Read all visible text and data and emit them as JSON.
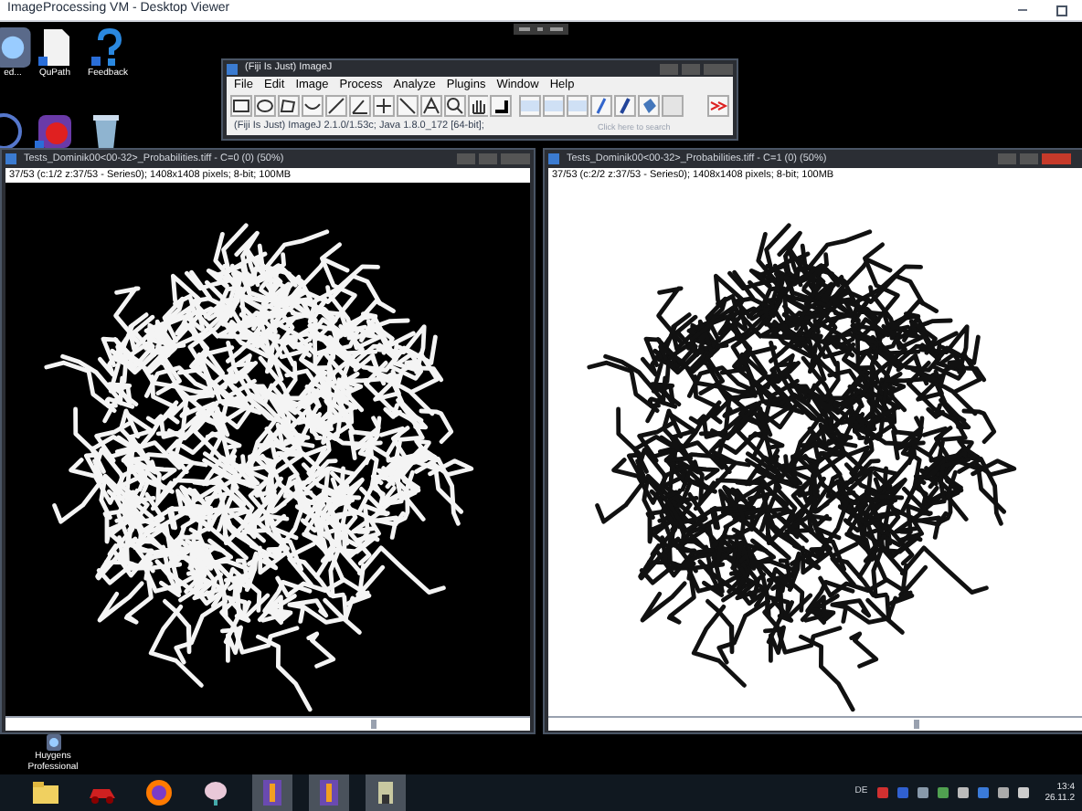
{
  "window": {
    "title": "ImageProcessing VM - Desktop Viewer"
  },
  "desktop_icons": [
    {
      "label": "ed...",
      "kind": "app"
    },
    {
      "label": "QuPath",
      "kind": "file"
    },
    {
      "label": "Feedback",
      "kind": "help"
    },
    {
      "label": "Huygens\nProfessional",
      "kind": "app"
    }
  ],
  "fiji": {
    "title": "(Fiji Is Just) ImageJ",
    "menu": [
      "File",
      "Edit",
      "Image",
      "Process",
      "Analyze",
      "Plugins",
      "Window",
      "Help"
    ],
    "status": "(Fiji Is Just) ImageJ 2.1.0/1.53c; Java 1.8.0_172 [64-bit];",
    "search_placeholder": "Click here to search"
  },
  "image_windows": [
    {
      "title": "Tests_Dominik00<00-32>_Probabilities.tiff - C=0 (0) (50%)",
      "info": "37/53 (c:1/2 z:37/53 - Series0); 1408x1408 pixels; 8-bit; 100MB",
      "inverted": false
    },
    {
      "title": "Tests_Dominik00<00-32>_Probabilities.tiff - C=1 (0) (50%)",
      "info": "37/53 (c:2/2 z:37/53 - Series0); 1408x1408 pixels; 8-bit; 100MB",
      "inverted": true
    }
  ],
  "taskbar": {
    "language": "DE",
    "time": "13:4",
    "date": "26.11.2"
  }
}
